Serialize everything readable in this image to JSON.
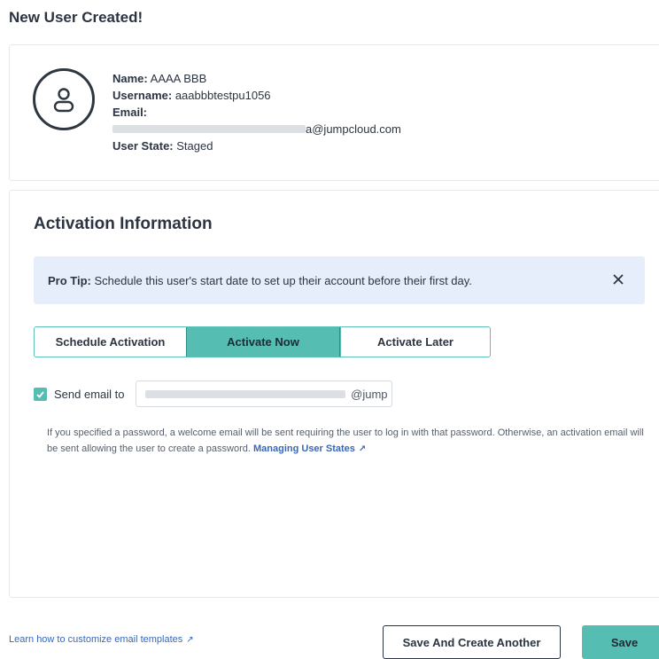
{
  "page": {
    "title": "New User Created!"
  },
  "user": {
    "name_label": "Name:",
    "name": "AAAA BBB",
    "username_label": "Username:",
    "username": "aaabbbtestpu1056",
    "email_label": "Email:",
    "email_suffix": "a@jumpcloud.com",
    "state_label": "User State:",
    "state": "Staged"
  },
  "activation": {
    "title": "Activation Information",
    "tip_label": "Pro Tip:",
    "tip_text": "Schedule this user's start date to set up their account before their first day.",
    "options": [
      "Schedule Activation",
      "Activate Now",
      "Activate Later"
    ],
    "selected_index": 1,
    "send_email_label": "Send email to",
    "send_email_checked": true,
    "email_domain_fragment": "@jump",
    "help_text": "If you specified a password, a welcome email will be sent requiring the user to log in with that password. Otherwise, an activation email will be sent allowing the user to create a password.",
    "help_link": "Managing User States"
  },
  "footer": {
    "template_link": "Learn how to customize email templates",
    "save_and_create_label": "Save And Create Another",
    "save_label": "Save"
  },
  "colors": {
    "accent": "#56bdb2",
    "link": "#3967b8",
    "tip_bg": "#e7eefb"
  }
}
